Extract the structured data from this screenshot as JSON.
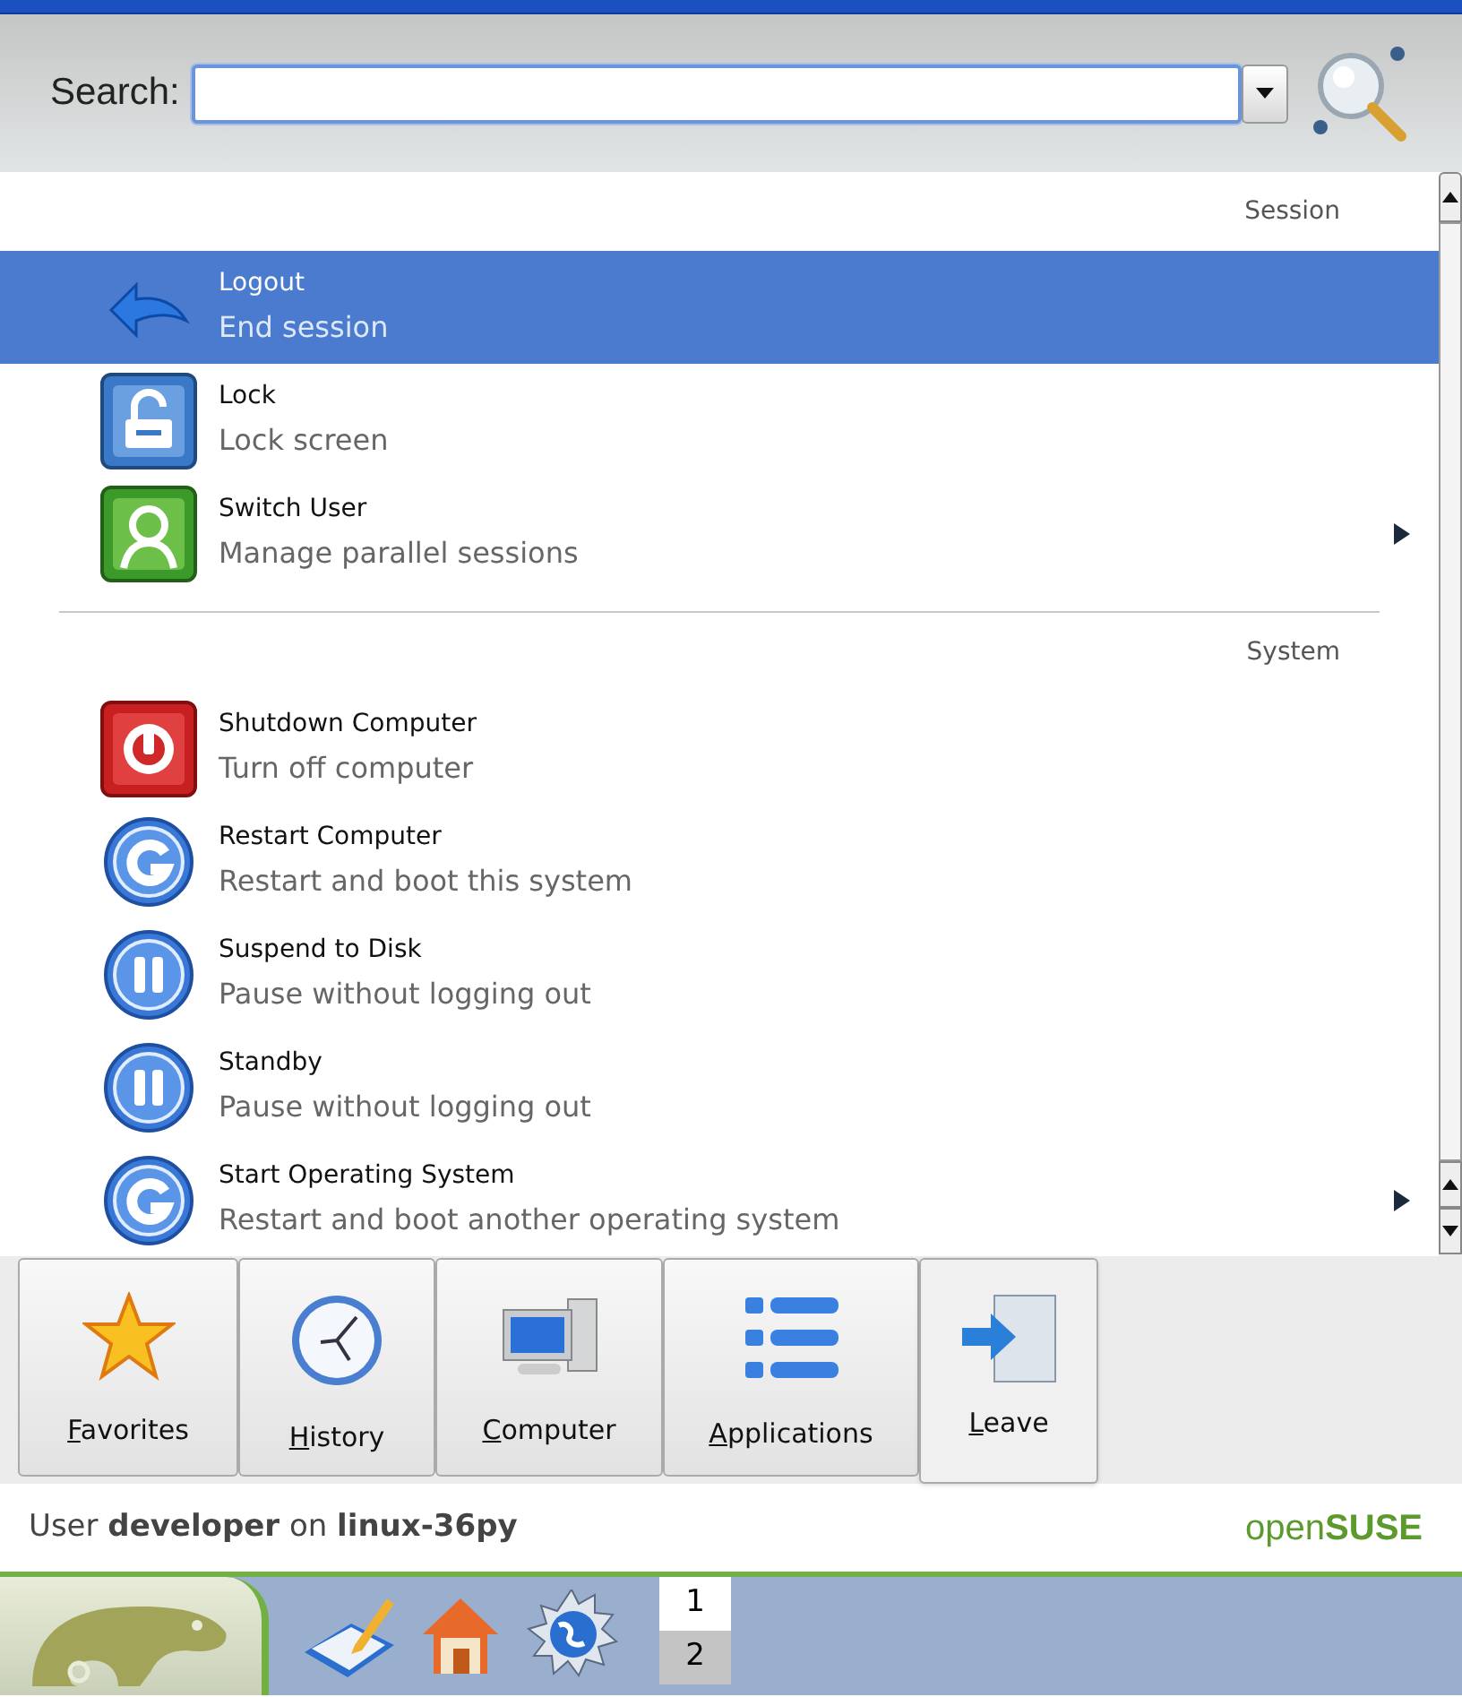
{
  "search": {
    "label": "Search:"
  },
  "sections": [
    {
      "title": "Session",
      "items": [
        {
          "title": "Logout",
          "subtitle": "End session",
          "selected": true,
          "has_submenu": false
        },
        {
          "title": "Lock",
          "subtitle": "Lock screen",
          "selected": false,
          "has_submenu": false
        },
        {
          "title": "Switch User",
          "subtitle": "Manage parallel sessions",
          "selected": false,
          "has_submenu": true
        }
      ]
    },
    {
      "title": "System",
      "items": [
        {
          "title": "Shutdown Computer",
          "subtitle": "Turn off computer",
          "selected": false,
          "has_submenu": false
        },
        {
          "title": "Restart Computer",
          "subtitle": "Restart and boot this system",
          "selected": false,
          "has_submenu": false
        },
        {
          "title": "Suspend to Disk",
          "subtitle": "Pause without logging out",
          "selected": false,
          "has_submenu": false
        },
        {
          "title": "Standby",
          "subtitle": "Pause without logging out",
          "selected": false,
          "has_submenu": false
        },
        {
          "title": "Start Operating System",
          "subtitle": "Restart and boot another operating system",
          "selected": false,
          "has_submenu": true
        }
      ]
    }
  ],
  "tabs": [
    {
      "label": "Favorites",
      "selected": false
    },
    {
      "label": "History",
      "selected": false
    },
    {
      "label": "Computer",
      "selected": false
    },
    {
      "label": "Applications",
      "selected": false
    },
    {
      "label": "Leave",
      "selected": true
    }
  ],
  "footer": {
    "user_line": "User **developer** on **linux-36py**",
    "brand": "open**SUSE**"
  },
  "taskbar": {
    "desktops": [
      {
        "label": "1",
        "selected": true
      },
      {
        "label": "2",
        "selected": false
      }
    ]
  }
}
